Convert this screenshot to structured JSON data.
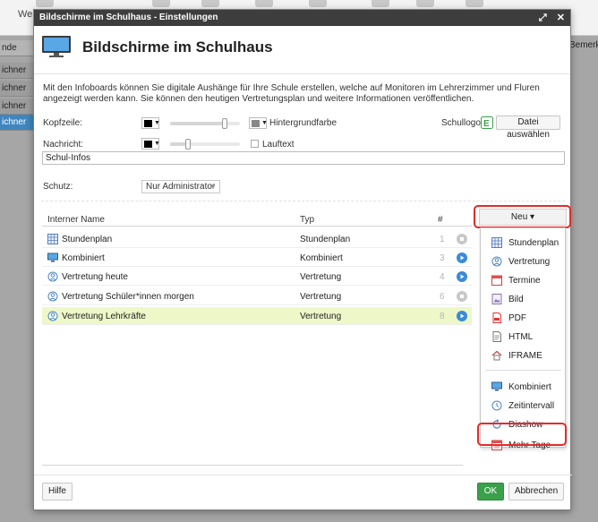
{
  "background": {
    "toolbar_label": "Wer",
    "left_col_header": "nde",
    "left_rows": [
      "ichner",
      "ichner",
      "ichner",
      "ichner"
    ],
    "right_col_header": "Bemerku"
  },
  "dialog": {
    "window_title": "Bildschirme im Schulhaus - Einstellungen",
    "heading": "Bildschirme im Schulhaus",
    "description": "Mit den Infoboards können Sie digitale Aushänge für Ihre Schule erstellen, welche auf Monitoren im Lehrerzimmer und Fluren angezeigt werden kann. Sie können den heutigen Vertretungsplan und weitere Informationen veröffentlichen.",
    "kopfzeile_label": "Kopfzeile:",
    "hintergrundfarbe_label": "Hintergrundfarbe",
    "schullogo_label": "Schullogo:",
    "datei_button": "Datei auswählen",
    "nachricht_label": "Nachricht:",
    "lauftext_label": "Lauftext",
    "nachricht_value": "Schul-Infos",
    "schutz_label": "Schutz:",
    "schutz_value": "Nur Administrator",
    "sliders": {
      "kopfzeile": 0.78,
      "nachricht": 0.25
    }
  },
  "table": {
    "col_name": "Interner Name",
    "col_type": "Typ",
    "col_hash": "#",
    "rows": [
      {
        "name": "Stundenplan",
        "type": "Stundenplan",
        "num": "1",
        "icon": "calendar-grid-icon",
        "action": "stop",
        "selected": false
      },
      {
        "name": "Kombiniert",
        "type": "Kombiniert",
        "num": "3",
        "icon": "monitor-icon",
        "action": "play",
        "selected": false
      },
      {
        "name": "Vertretung heute",
        "type": "Vertretung",
        "num": "4",
        "icon": "substitution-icon",
        "action": "play",
        "selected": false
      },
      {
        "name": "Vertretung Schüler*innen morgen",
        "type": "Vertretung",
        "num": "6",
        "icon": "substitution-icon",
        "action": "stop",
        "selected": false
      },
      {
        "name": "Vertretung Lehrkräfte",
        "type": "Vertretung",
        "num": "8",
        "icon": "substitution-icon",
        "action": "play",
        "selected": true
      }
    ]
  },
  "neu_menu": {
    "button_label": "Neu ▾",
    "items": [
      {
        "label": "Stundenplan",
        "icon": "calendar-grid-icon"
      },
      {
        "label": "Vertretung",
        "icon": "substitution-icon"
      },
      {
        "label": "Termine",
        "icon": "calendar-icon"
      },
      {
        "label": "Bild",
        "icon": "image-icon"
      },
      {
        "label": "PDF",
        "icon": "pdf-icon"
      },
      {
        "label": "HTML",
        "icon": "html-icon"
      },
      {
        "label": "IFRAME",
        "icon": "house-icon"
      },
      {
        "label": "Kombiniert",
        "icon": "monitor-icon"
      },
      {
        "label": "Zeitintervall",
        "icon": "clock-icon"
      },
      {
        "label": "Diashow",
        "icon": "slideshow-icon"
      },
      {
        "label": "Mehr Tage",
        "icon": "multi-day-icon"
      }
    ]
  },
  "footer": {
    "hilfe": "Hilfe",
    "ok": "OK",
    "abbrechen": "Abbrechen"
  },
  "colors": {
    "accent_blue": "#3a8bd8",
    "ok_green": "#3aa04a",
    "highlight_red": "#e32b2b",
    "selected_row": "#eef7c8",
    "titlebar": "#3d3d3d"
  }
}
